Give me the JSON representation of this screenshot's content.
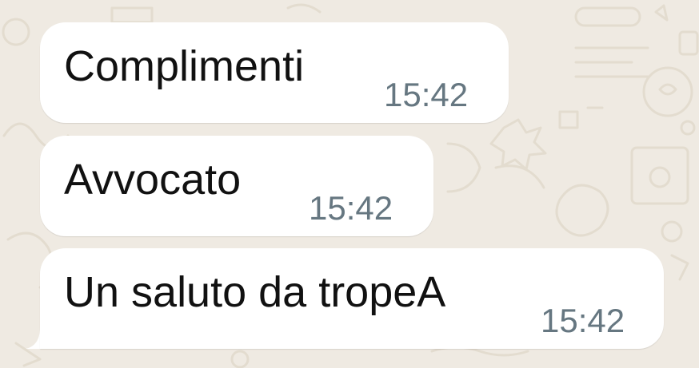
{
  "theme": {
    "background": "#efeae2",
    "bubble": "#ffffff",
    "message_text": "#111111",
    "time_text": "#667781"
  },
  "chat": {
    "messages": [
      {
        "text": "Complimenti",
        "time": "15:42"
      },
      {
        "text": "Avvocato",
        "time": "15:42"
      },
      {
        "text": "Un saluto da tropeA",
        "time": "15:42"
      }
    ]
  }
}
